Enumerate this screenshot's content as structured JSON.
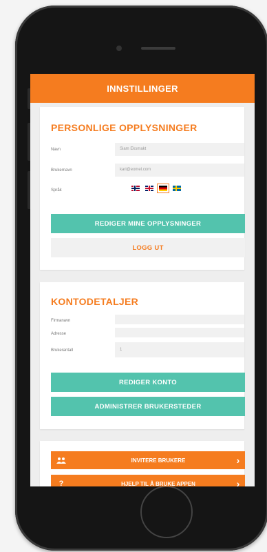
{
  "header": {
    "title": "INNSTILLINGER"
  },
  "personal": {
    "title": "PERSONLIGE OPPLYSNINGER",
    "fields": [
      {
        "label": "Navn",
        "value": "Siam Eksmakt"
      },
      {
        "label": "Brukernavn",
        "value": "kari@eomel.com"
      }
    ],
    "language_label": "Språk",
    "flags": [
      "no",
      "uk",
      "de",
      "se"
    ],
    "selected_flag": "de",
    "edit_button": "REDIGER MINE OPPLYSNINGER",
    "logout_button": "LOGG UT"
  },
  "account": {
    "title": "KONTODETALJER",
    "fields": [
      {
        "label": "Firmanavn",
        "value": ""
      },
      {
        "label": "Adresse",
        "value": ""
      },
      {
        "label": "Brukerantall",
        "value": "1"
      }
    ],
    "edit_button": "REDIGER KONTO",
    "admin_button": "ADMINISTRER BRUKERSTEDER"
  },
  "actions": [
    {
      "icon": "users-icon",
      "label": "INVITERE BRUKERE"
    },
    {
      "icon": "help-icon",
      "label": "HJELP TIL Å BRUKE APPEN"
    }
  ],
  "colors": {
    "accent": "#f57c1f",
    "teal": "#53c3ad"
  }
}
